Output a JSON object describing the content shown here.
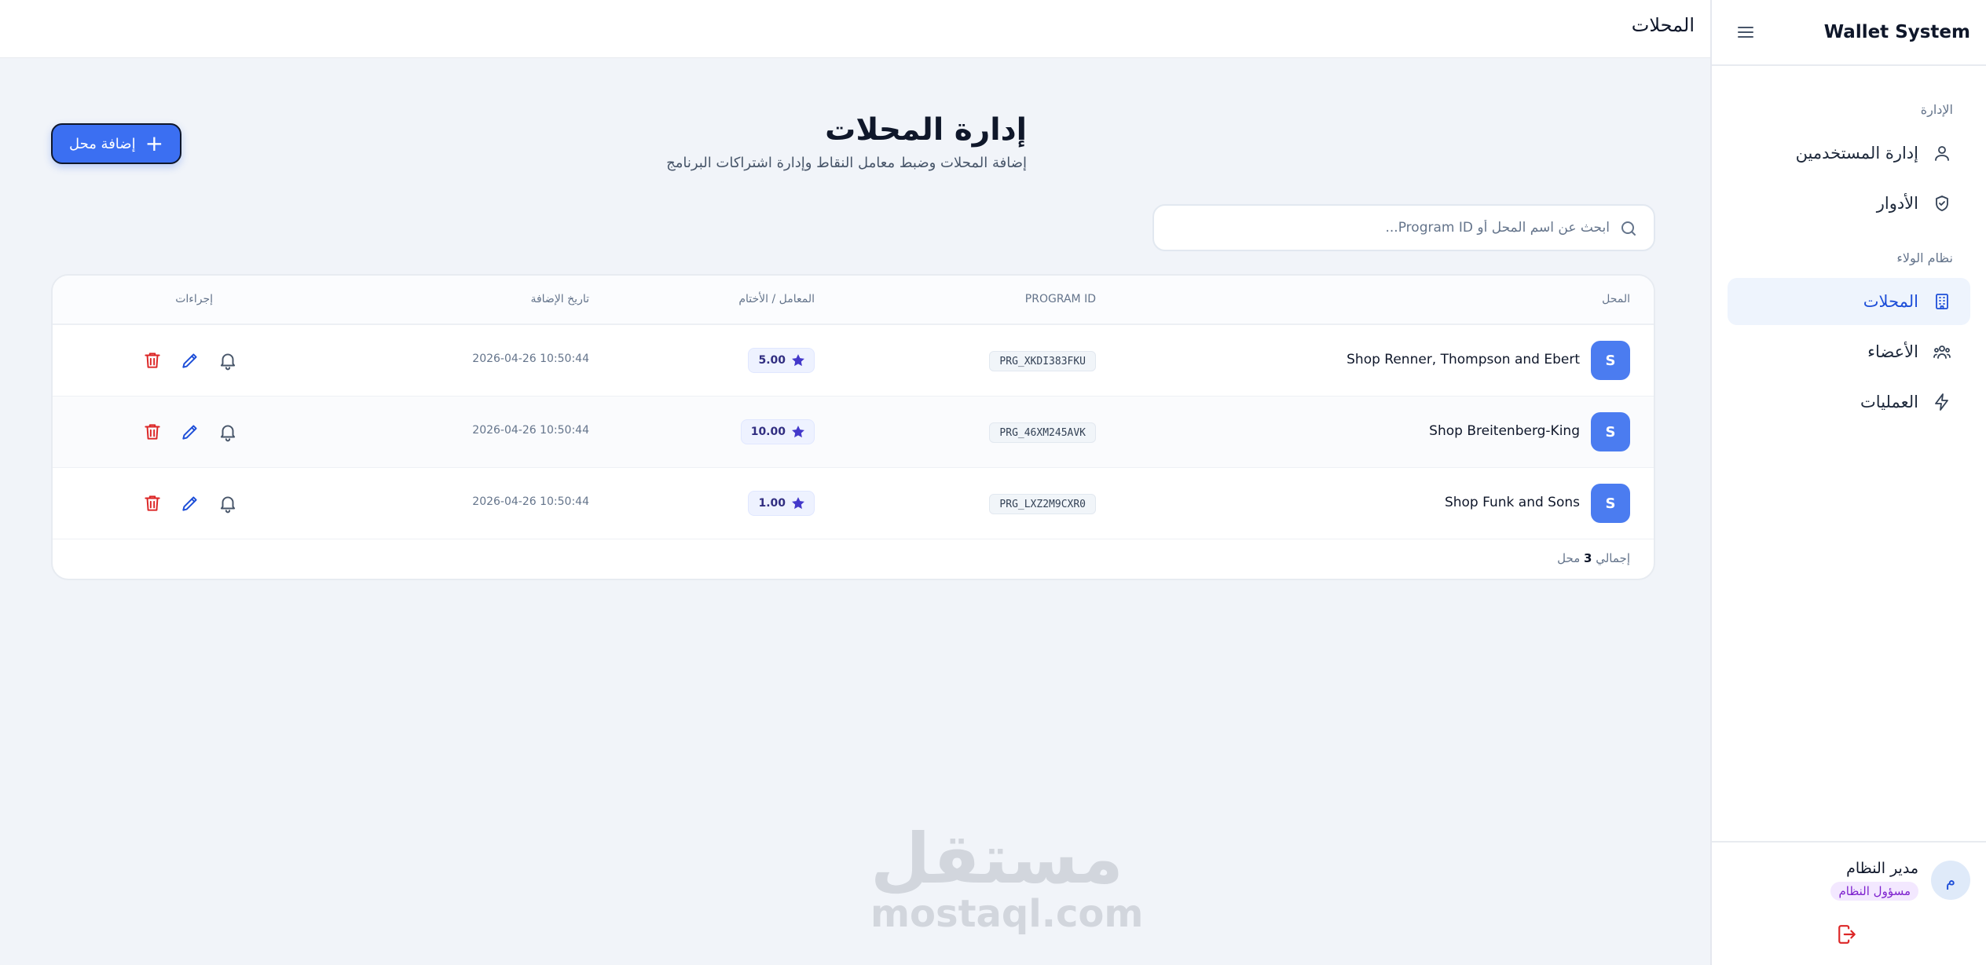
{
  "sidebar": {
    "brand": "Wallet System",
    "sections": [
      {
        "title": "الإدارة",
        "items": [
          {
            "label": "إدارة المستخدمين",
            "icon": "users-icon"
          },
          {
            "label": "الأدوار",
            "icon": "shield-check-icon"
          }
        ]
      },
      {
        "title": "نظام الولاء",
        "items": [
          {
            "label": "المحلات",
            "icon": "building-icon",
            "active": true
          },
          {
            "label": "الأعضاء",
            "icon": "members-icon"
          },
          {
            "label": "العمليات",
            "icon": "bolt-icon"
          }
        ]
      }
    ],
    "user": {
      "avatar_letter": "م",
      "name": "مدير النظام",
      "role": "مسؤول النظام"
    }
  },
  "topbar": {
    "title": "المحلات"
  },
  "page": {
    "title": "إدارة المحلات",
    "subtitle": "إضافة المحلات وضبط معامل النقاط وإدارة اشتراكات البرنامج",
    "add_button": "إضافة محل"
  },
  "search": {
    "placeholder": "ابحث عن اسم المحل أو Program ID..."
  },
  "table": {
    "columns": {
      "shop": "المحل",
      "program_id": "PROGRAM ID",
      "multiplier": "المعامل / الأختام",
      "date": "تاريخ الإضافة",
      "actions": "إجراءات"
    },
    "rows": [
      {
        "avatar": "S",
        "name": "Shop Renner, Thompson and Ebert",
        "program_id": "PRG_XKDI383FKU",
        "multiplier": "5.00",
        "date": "2026-04-26 10:50:44"
      },
      {
        "avatar": "S",
        "name": "Shop Breitenberg-King",
        "program_id": "PRG_46XM245AVK",
        "multiplier": "10.00",
        "date": "2026-04-26 10:50:44"
      },
      {
        "avatar": "S",
        "name": "Shop Funk and Sons",
        "program_id": "PRG_LXZ2M9CXR0",
        "multiplier": "1.00",
        "date": "2026-04-26 10:50:44"
      }
    ],
    "footer": {
      "prefix": "إجمالي",
      "count": "3",
      "suffix": "محل"
    }
  },
  "watermark": {
    "arabic": "مستقل",
    "domain": "mostaql.com"
  },
  "colors": {
    "accent": "#3b6ff2",
    "active_bg": "#eef4fd",
    "danger": "#dc2626",
    "role_badge": "#7e22ce"
  }
}
